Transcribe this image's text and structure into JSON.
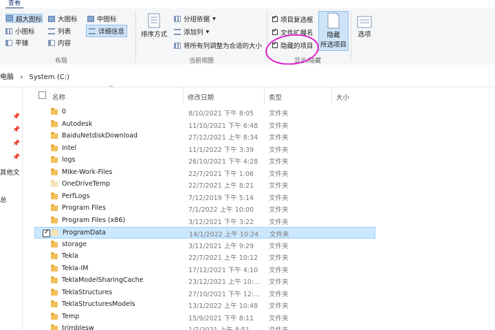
{
  "ribbon": {
    "active_tab": "查看",
    "layout": {
      "label": "布局",
      "items": [
        "超大图标",
        "大图标",
        "中图标",
        "小图标",
        "列表",
        "详细信息",
        "平铺",
        "内容"
      ]
    },
    "current_view": {
      "label": "当前视图",
      "sort": "排序方式",
      "group": "分组依据",
      "add_col": "添加列",
      "fit_cols": "将所有列调整为合适的大小"
    },
    "show_hide": {
      "label": "显示/隐藏",
      "checkbox_items": "项目复选框",
      "file_ext": "文件扩展名",
      "hidden_items": "隐藏的项目",
      "hide_selected_l1": "隐藏",
      "hide_selected_l2": "所选项目"
    },
    "options": "选项"
  },
  "address": {
    "root": "电脑",
    "location": "System (C:)"
  },
  "nav": {
    "other": "其他文",
    "total": "总"
  },
  "columns": {
    "name": "名称",
    "modified": "修改日期",
    "type": "类型",
    "size": "大小"
  },
  "files": [
    {
      "name": "0",
      "date": "8/10/2021 下午 8:05",
      "type": "文件夹"
    },
    {
      "name": "Autodesk",
      "date": "11/10/2021 下午 6:48",
      "type": "文件夹"
    },
    {
      "name": "BaiduNetdiskDownload",
      "date": "27/12/2021 上午 8:34",
      "type": "文件夹"
    },
    {
      "name": "Intel",
      "date": "11/1/2022 下午 3:39",
      "type": "文件夹"
    },
    {
      "name": "logs",
      "date": "26/10/2021 下午 4:28",
      "type": "文件夹"
    },
    {
      "name": "MIke-Work-Files",
      "date": "22/7/2021 下午 1:06",
      "type": "文件夹"
    },
    {
      "name": "OneDriveTemp",
      "date": "22/7/2021 上午 8:21",
      "type": "文件夹"
    },
    {
      "name": "PerfLogs",
      "date": "7/12/2019 下午 5:14",
      "type": "文件夹"
    },
    {
      "name": "Program Files",
      "date": "7/1/2022 上午 10:00",
      "type": "文件夹"
    },
    {
      "name": "Program Files (x86)",
      "date": "3/12/2021 下午 3:22",
      "type": "文件夹"
    },
    {
      "name": "ProgramData",
      "date": "14/1/2022 上午 10:24",
      "type": "文件夹"
    },
    {
      "name": "storage",
      "date": "3/11/2021 上午 9:29",
      "type": "文件夹"
    },
    {
      "name": "Tekla",
      "date": "22/7/2021 上午 10:12",
      "type": "文件夹"
    },
    {
      "name": "Tekla-IM",
      "date": "17/12/2021 下午 4:10",
      "type": "文件夹"
    },
    {
      "name": "TeklaModelSharingCache",
      "date": "23/12/2021 上午 10:...",
      "type": "文件夹"
    },
    {
      "name": "TeklaStructures",
      "date": "27/10/2021 下午 12:...",
      "type": "文件夹"
    },
    {
      "name": "TeklaStructuresModels",
      "date": "13/1/2022 上午 10:48",
      "type": "文件夹"
    },
    {
      "name": "Temp",
      "date": "15/9/2021 下午 8:11",
      "type": "文件夹"
    },
    {
      "name": "trimblesw",
      "date": "1/7/2021 上午 8:51",
      "type": "文件夹"
    }
  ]
}
